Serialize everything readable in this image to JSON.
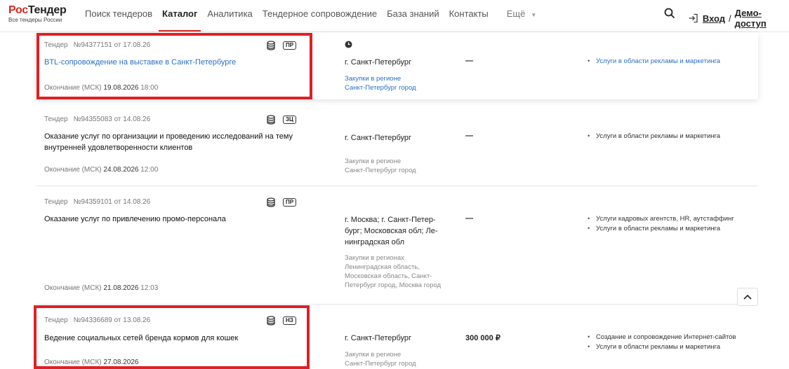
{
  "header": {
    "logo_prefix": "Рос",
    "logo_suffix": "Тендер",
    "logo_sub": "Все тендеры России",
    "nav": [
      "Поиск тендеров",
      "Каталог",
      "Аналитика",
      "Тендерное сопровождение",
      "База знаний",
      "Контакты"
    ],
    "more": "Ещё",
    "login": "Вход",
    "separator": "/",
    "demo": "Демо-доступ"
  },
  "tenders": [
    {
      "type": "Тендер",
      "number": "№94377151 от 17.08.26",
      "badge": "ПР",
      "title": "BTL-сопровождение на выставке в Санкт-Петербурге",
      "deadline_label": "Окончание (МСК)",
      "deadline_date": "19.08.2026",
      "deadline_time": "18:00",
      "region": "г. Санкт-Петербург",
      "region_sub_line1": "Закупки в регионе",
      "region_sub_line2": "Санкт-Петербург город",
      "price": "—",
      "categories": [
        "Услуги в области рекламы и маркетинга"
      ]
    },
    {
      "type": "Тендер",
      "number": "№94355083 от 14.08.26",
      "badge": "ЗЦ",
      "title": "Оказание услуг по организации и проведению исследований на тему внутренней удовлетворенности клиентов",
      "deadline_label": "Окончание (МСК)",
      "deadline_date": "24.08.2026",
      "deadline_time": "12:00",
      "region": "г. Санкт-Петербург",
      "region_sub_line1": "Закупки в регионе",
      "region_sub_line2": "Санкт-Петербург город",
      "price": "—",
      "categories": [
        "Услуги в области рекламы и маркетинга"
      ]
    },
    {
      "type": "Тендер",
      "number": "№94359101 от 14.08.26",
      "badge": "ПР",
      "title": "Оказание услуг по привлечению промо-персонала",
      "deadline_label": "Окончание (МСК)",
      "deadline_date": "21.08.2026",
      "deadline_time": "12:03",
      "region": "г. Москва; г. Санкт-Петер-бург; Московская обл; Ле-нинградская обл",
      "region_sub_line1": "Закупки в регионах",
      "region_sub_line2": "Ленинградская область, Московская область, Санкт-Петербург город, Москва город",
      "price": "—",
      "categories": [
        "Услуги кадровых агентств, HR, аутстаффинг",
        "Услуги в области рекламы и маркетинга"
      ]
    },
    {
      "type": "Тендер",
      "number": "№94336689 от 13.08.26",
      "badge": "НЗ",
      "title": "Ведение социальных сетей бренда кормов для кошек",
      "deadline_label": "Окончание (МСК)",
      "deadline_date": "27.08.2026",
      "deadline_time": "",
      "region": "г. Санкт-Петербург",
      "region_sub_line1": "Закупки в регионе",
      "region_sub_line2": "Санкт-Петербург город",
      "price": "300 000 ₽",
      "categories": [
        "Создание и сопровождение Интернет-сайтов",
        "Услуги в области рекламы и маркетинга"
      ]
    }
  ],
  "colors": {
    "accent": "#d52b1e",
    "link": "#2a6fc9",
    "highlight": "#e01f26"
  }
}
